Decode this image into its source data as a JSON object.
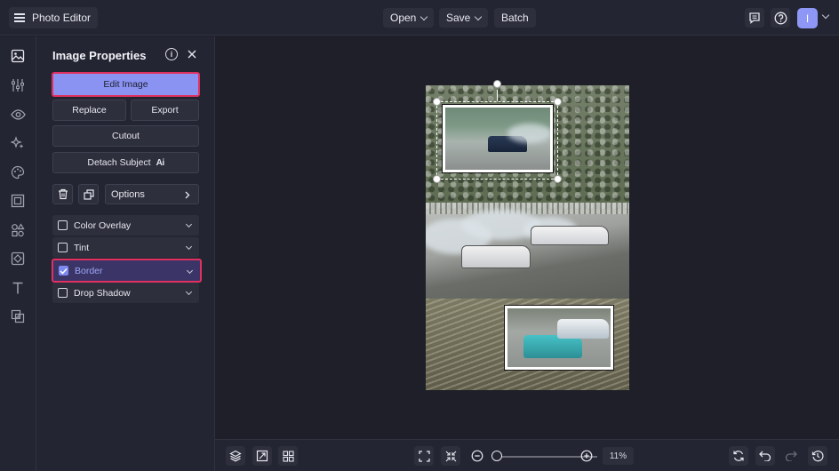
{
  "topbar": {
    "app_title": "Photo Editor",
    "menu_open": "Open",
    "menu_save": "Save",
    "menu_batch": "Batch",
    "avatar_initial": "I"
  },
  "panel": {
    "title": "Image Properties",
    "edit_image": "Edit Image",
    "replace": "Replace",
    "export": "Export",
    "cutout": "Cutout",
    "detach_subject": "Detach Subject",
    "ai_badge": "Ai",
    "options": "Options",
    "effects": [
      {
        "label": "Color Overlay",
        "checked": false
      },
      {
        "label": "Tint",
        "checked": false
      },
      {
        "label": "Border",
        "checked": true
      },
      {
        "label": "Drop Shadow",
        "checked": false
      }
    ]
  },
  "rail": {
    "icons": [
      "image-icon",
      "sliders-icon",
      "eye-icon",
      "sparkle-icon",
      "palette-icon",
      "frame-icon",
      "shapes-icon",
      "texture-icon",
      "text-icon",
      "overlay-icon"
    ]
  },
  "bottombar": {
    "zoom": "11%",
    "zoom_level_percent": 11
  },
  "colors": {
    "accent": "#8a93f2",
    "highlight_border": "#e0305f",
    "background": "#1e1f29",
    "panel": "#242532"
  }
}
